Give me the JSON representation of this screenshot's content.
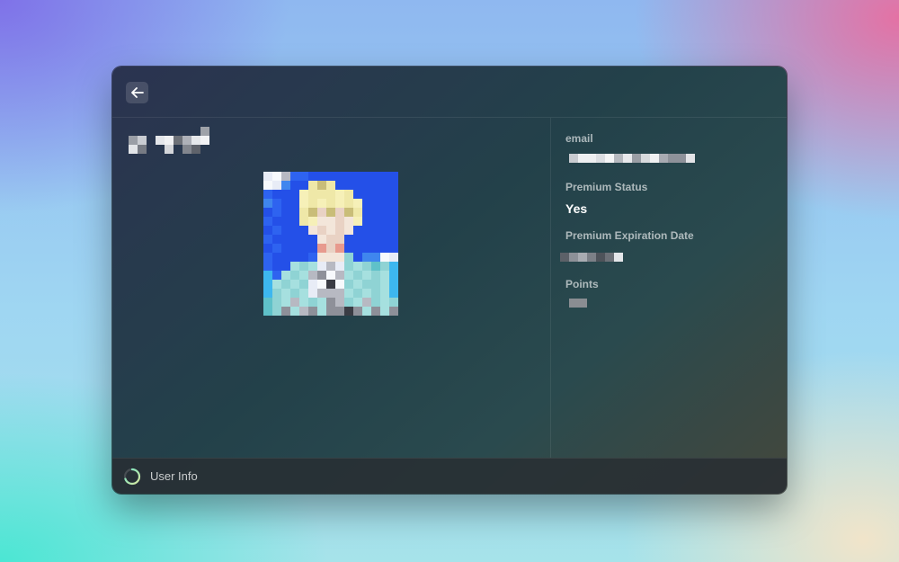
{
  "window": {
    "back_label": "Back"
  },
  "profile": {
    "username_redacted": true
  },
  "fields": [
    {
      "label": "email",
      "value_redacted": true
    },
    {
      "label": "Premium Status",
      "value": "Yes"
    },
    {
      "label": "Premium Expiration Date",
      "value_redacted": true
    },
    {
      "label": "Points",
      "value_redacted": true
    }
  ],
  "footer": {
    "title": "User Info",
    "spinner_icon": "loading-spinner-icon"
  },
  "icons": {
    "back": "arrow-left-icon"
  },
  "colors": {
    "accent_spinner_start": "#6fe3c4",
    "accent_spinner_end": "#d8e8a0"
  }
}
